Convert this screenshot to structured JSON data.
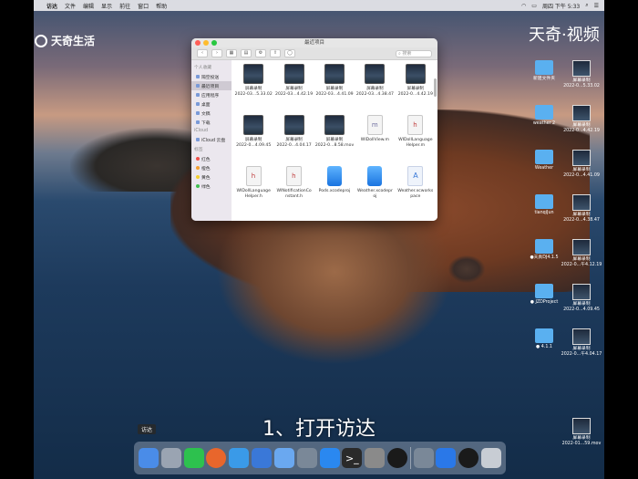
{
  "menubar": {
    "apple_glyph": "",
    "items": [
      "访达",
      "文件",
      "编辑",
      "显示",
      "前往",
      "窗口",
      "帮助"
    ],
    "clock": "周四 下午 5:33"
  },
  "watermarks": {
    "left": "天奇生活",
    "right": "天奇·视频"
  },
  "finder": {
    "title": "最近项目",
    "search_placeholder": "搜索",
    "sidebar": {
      "sections": [
        {
          "header": "个人收藏",
          "items": [
            "隔空投送",
            "最近项目",
            "应用程序",
            "桌面",
            "文稿",
            "下载"
          ],
          "selected": 1
        },
        {
          "header": "iCloud",
          "items": [
            "iCloud 云盘"
          ]
        },
        {
          "header": "标签",
          "items": [
            "红色",
            "橙色",
            "黄色",
            "绿色"
          ]
        }
      ]
    },
    "files": [
      {
        "kind": "shot",
        "name": "屏幕录制",
        "sub": "2022-03...5.33.02"
      },
      {
        "kind": "shot",
        "name": "屏幕录制",
        "sub": "2022-03...4.42.19"
      },
      {
        "kind": "shot",
        "name": "屏幕录制",
        "sub": "2022-03...4.41.09"
      },
      {
        "kind": "shot",
        "name": "屏幕录制",
        "sub": "2022-03...4.38.47"
      },
      {
        "kind": "shot",
        "name": "屏幕录制",
        "sub": "2022-0...4.42.19"
      },
      {
        "kind": "shot",
        "name": "屏幕录制",
        "sub": "2022-0...4.09.45"
      },
      {
        "kind": "shot",
        "name": "屏幕录制",
        "sub": "2022-0...4.04.17"
      },
      {
        "kind": "shot",
        "name": "屏幕录制",
        "sub": "2022-0...8.58.mov"
      },
      {
        "kind": "doc m",
        "name": "WIDollView.m",
        "sub": ""
      },
      {
        "kind": "doc h",
        "name": "WIDollLanguage",
        "sub": "Helper.m"
      },
      {
        "kind": "doc h",
        "name": "WIDollLanguage",
        "sub": "Helper.h"
      },
      {
        "kind": "doc h",
        "name": "WINotificationCo",
        "sub": "nstant.h"
      },
      {
        "kind": "xc",
        "name": "Pods.xcodeproj",
        "sub": ""
      },
      {
        "kind": "xc",
        "name": "Weather.xcodepr",
        "sub": "oj"
      },
      {
        "kind": "ws",
        "name": "Weather.xcworks",
        "sub": "pace"
      }
    ]
  },
  "desktop_icons": [
    {
      "type": "folder",
      "label": "新建文件夹"
    },
    {
      "type": "shot",
      "label": "屏幕录制",
      "sub": "2022-0...5.33.02"
    },
    {
      "type": "folder",
      "label": "weather 2"
    },
    {
      "type": "shot",
      "label": "屏幕录制",
      "sub": "2022-0...4.42.19"
    },
    {
      "type": "folder",
      "label": "Weather"
    },
    {
      "type": "shot",
      "label": "屏幕录制",
      "sub": "2022-0...4.41.09"
    },
    {
      "type": "folder",
      "label": "tianqiJun"
    },
    {
      "type": "shot",
      "label": "屏幕录制",
      "sub": "2022-0...4.38.47"
    },
    {
      "type": "folder",
      "label": "●天真DJ4.1.5"
    },
    {
      "type": "shot",
      "label": "屏幕录制",
      "sub": "2022-0...午4.12.19"
    },
    {
      "type": "folder",
      "label": "● JZDProject"
    },
    {
      "type": "shot",
      "label": "屏幕录制",
      "sub": "2022-0...4.09.45"
    },
    {
      "type": "folder",
      "label": "● 4.1.1"
    },
    {
      "type": "shot",
      "label": "屏幕录制",
      "sub": "2022-0...午4.04.17"
    },
    {
      "type": "shot",
      "label": "屏幕录制",
      "sub": "2022-01...59.mov"
    }
  ],
  "subtitle": "1、打开访达",
  "dock": {
    "tooltip": "访达",
    "apps": [
      {
        "name": "finder",
        "glyph": "",
        "color": "#4a8ce8"
      },
      {
        "name": "launchpad",
        "glyph": "",
        "color": "#9aa4b2"
      },
      {
        "name": "wechat",
        "glyph": "",
        "color": "#2dc14e"
      },
      {
        "name": "firefox",
        "glyph": "",
        "color": "#e8662c"
      },
      {
        "name": "safari",
        "glyph": "",
        "color": "#3a9ae8"
      },
      {
        "name": "xcode",
        "glyph": "",
        "color": "#3a78d8"
      },
      {
        "name": "finder-folder",
        "glyph": "",
        "color": "#6aa8f0"
      },
      {
        "name": "instruments",
        "glyph": "",
        "color": "#7a8898"
      },
      {
        "name": "app-store",
        "glyph": "",
        "color": "#2a88f0"
      },
      {
        "name": "terminal",
        "glyph": ">_",
        "color": "#2a2a2a"
      },
      {
        "name": "preferences",
        "glyph": "",
        "color": "#8a8a8a"
      },
      {
        "name": "qq",
        "glyph": "",
        "color": "#1a1a1a"
      },
      {
        "name": "sep",
        "glyph": "",
        "color": ""
      },
      {
        "name": "xcode-tools",
        "glyph": "",
        "color": "#7a8898"
      },
      {
        "name": "qq-browser",
        "glyph": "",
        "color": "#2a78e8"
      },
      {
        "name": "qq-2",
        "glyph": "",
        "color": "#1a1a1a"
      },
      {
        "name": "trash",
        "glyph": "",
        "color": "#c8cdd4"
      }
    ]
  }
}
